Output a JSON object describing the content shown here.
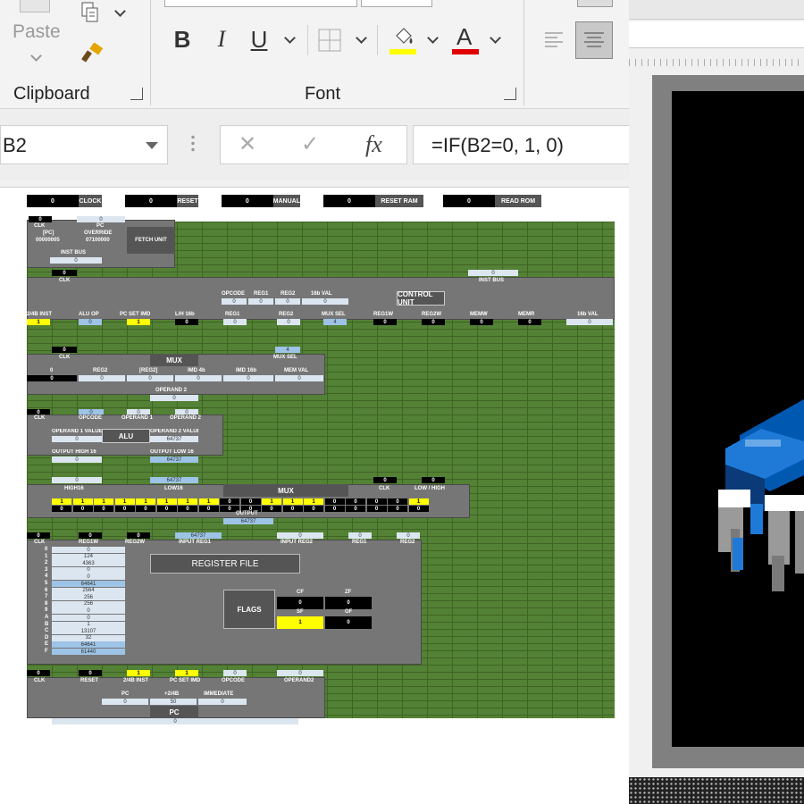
{
  "ribbon": {
    "clipboard": {
      "label": "Clipboard",
      "paste_label": "Paste"
    },
    "font": {
      "label": "Font",
      "bold": "B",
      "italic": "I",
      "underline": "U",
      "font_color_glyph": "A",
      "fill_color": "#ffff00",
      "font_color": "#e00000"
    }
  },
  "formula_bar": {
    "name_box": "B2",
    "cancel": "✕",
    "enter": "✓",
    "fx": "fx",
    "formula": "=IF(B2=0, 1, 0)"
  },
  "sheet": {
    "colors": {
      "green": "#538135",
      "panel": "#767676",
      "yellow": "#ffff00",
      "light_blue": "#dce6f1"
    },
    "controls": [
      {
        "value": "0",
        "label": "CLOCK"
      },
      {
        "value": "0",
        "label": "RESET"
      },
      {
        "value": "0",
        "label": "MANUAL"
      },
      {
        "value": "0",
        "label": "RESET RAM"
      },
      {
        "value": "0",
        "label": "READ ROM"
      }
    ],
    "fetch": {
      "clk_val": "0",
      "clk": "CLK",
      "pc_val": "0",
      "pc": "PC",
      "pc_reg": "[PC]",
      "pc_reg_val": "00000005",
      "override": "OVERRIDE",
      "override_val": "07100000",
      "title": "FETCH UNIT",
      "inst_bus": "INST BUS",
      "inst_bus_val": "0"
    },
    "control_unit": {
      "clk_val": "0",
      "clk": "CLK",
      "inst_bus_val": "0",
      "inst_bus": "INST BUS",
      "title": "CONTROL UNIT",
      "fields": [
        {
          "label": "OPCODE",
          "value": "0"
        },
        {
          "label": "REG1",
          "value": "0"
        },
        {
          "label": "REG2",
          "value": "0"
        },
        {
          "label": "16b VAL",
          "value": "0"
        }
      ],
      "outputs": [
        {
          "label": "2/4B INST",
          "value": "1"
        },
        {
          "label": "ALU OP",
          "value": "0"
        },
        {
          "label": "PC SET IMD",
          "value": "1"
        },
        {
          "label": "L/H 16b",
          "value": "0"
        },
        {
          "label": "REG1",
          "value": "0"
        },
        {
          "label": "REG2",
          "value": "0"
        },
        {
          "label": "MUX SEL",
          "value": "4"
        },
        {
          "label": "REG1W",
          "value": "0"
        },
        {
          "label": "REG2W",
          "value": "0"
        },
        {
          "label": "MEMW",
          "value": "0"
        },
        {
          "label": "MEMR",
          "value": "0"
        },
        {
          "label": "16b VAL",
          "value": "0"
        }
      ]
    },
    "mux1": {
      "clk_val": "0",
      "clk": "CLK",
      "sel_val": "4",
      "sel": "MUX SEL",
      "title": "MUX",
      "inputs": [
        {
          "label": "0",
          "value": "0"
        },
        {
          "label": "REG2",
          "value": "0"
        },
        {
          "label": "[REG2]",
          "value": "0"
        },
        {
          "label": "IMD 4b",
          "value": "0"
        },
        {
          "label": "IMD 16b",
          "value": "0"
        },
        {
          "label": "MEM VAL",
          "value": "0"
        }
      ],
      "operand2": "OPERAND 2",
      "operand2_val": "0"
    },
    "alu": {
      "title": "ALU",
      "clk_val": "0",
      "clk": "CLK",
      "opcode_val": "0",
      "opcode": "OPCODE",
      "op1_val": "0",
      "op1": "OPERAND 1",
      "op2_val": "0",
      "op2": "OPERAND 2",
      "op1_value_label": "OPERAND 1 VALUE",
      "op1_value": "0",
      "op2_value_label": "OPERAND 2 VALUE",
      "op2_value": "64737",
      "out_high_label": "OUTPUT HIGH 16",
      "out_high": "0",
      "out_low_label": "OUTPUT LOW 16",
      "out_low": "64737"
    },
    "mux2": {
      "title": "MUX",
      "high16_val": "0",
      "high16": "HIGH16",
      "low16_val": "64737",
      "low16": "LOW16",
      "clk_val": "0",
      "clk": "CLK",
      "lh_val": "0",
      "lh": "LOW / HIGH",
      "bits_row1": [
        "1",
        "1",
        "1",
        "1",
        "1",
        "1",
        "1",
        "1",
        "0",
        "0",
        "1",
        "1",
        "1",
        "0",
        "0",
        "0",
        "0",
        "1"
      ],
      "bits_row2": [
        "0",
        "0",
        "0",
        "0",
        "0",
        "0",
        "0",
        "0",
        "0",
        "0",
        "0",
        "0",
        "0",
        "0",
        "0",
        "0",
        "0",
        "0"
      ],
      "output": "OUTPUT",
      "output_val": "64737"
    },
    "register_file": {
      "title": "REGISTER FILE",
      "top_labels": [
        {
          "label": "CLK",
          "value": "0"
        },
        {
          "label": "REG1W",
          "value": "0"
        },
        {
          "label": "REG2W",
          "value": "0"
        },
        {
          "label": "INPUT REG1",
          "value": "64737"
        },
        {
          "label": "INPUT REG2",
          "value": "0"
        },
        {
          "label": "REG1",
          "value": "0"
        },
        {
          "label": "REG2",
          "value": "0"
        }
      ],
      "registers": [
        {
          "idx": "0",
          "value": "0"
        },
        {
          "idx": "1",
          "value": "124"
        },
        {
          "idx": "2",
          "value": "4363"
        },
        {
          "idx": "3",
          "value": "0"
        },
        {
          "idx": "4",
          "value": "0"
        },
        {
          "idx": "5",
          "value": "64641"
        },
        {
          "idx": "6",
          "value": "2564"
        },
        {
          "idx": "7",
          "value": "256"
        },
        {
          "idx": "8",
          "value": "256"
        },
        {
          "idx": "9",
          "value": "0"
        },
        {
          "idx": "A",
          "value": "0"
        },
        {
          "idx": "B",
          "value": "1"
        },
        {
          "idx": "C",
          "value": "13107"
        },
        {
          "idx": "D",
          "value": "32"
        },
        {
          "idx": "E",
          "value": "64641"
        },
        {
          "idx": "F",
          "value": "61440"
        }
      ],
      "flags_title": "FLAGS",
      "flags": [
        {
          "label": "CF",
          "value": "0"
        },
        {
          "label": "ZF",
          "value": "0"
        },
        {
          "label": "SF",
          "value": "1"
        },
        {
          "label": "OF",
          "value": "0"
        }
      ]
    },
    "pc_unit": {
      "title": "PC",
      "inputs": [
        {
          "label": "CLK",
          "value": "0"
        },
        {
          "label": "RESET",
          "value": "0"
        },
        {
          "label": "2/4B INST",
          "value": "1"
        },
        {
          "label": "PC SET IMD",
          "value": "1"
        },
        {
          "label": "OPCODE",
          "value": "0"
        },
        {
          "label": "OPERAND2",
          "value": "0"
        }
      ],
      "fields": [
        {
          "label": "PC",
          "value": "0"
        },
        {
          "label": "+2/4B",
          "value": "50"
        },
        {
          "label": "IMMEDIATE",
          "value": "0"
        }
      ],
      "out_val": "0"
    }
  }
}
